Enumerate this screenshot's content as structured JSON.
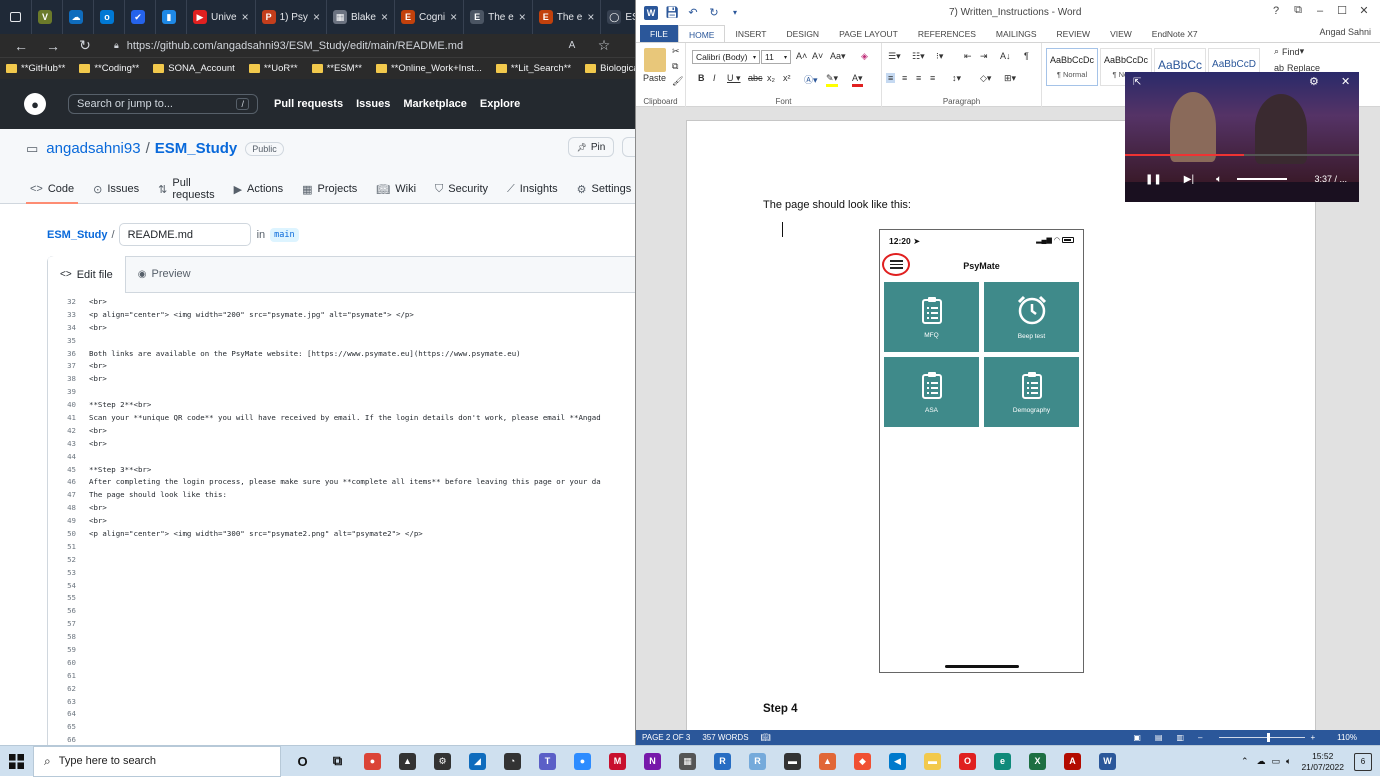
{
  "browser": {
    "tabs": [
      {
        "icon": "V",
        "color": "#6b7a2a",
        "label": ""
      },
      {
        "icon": "☁",
        "color": "#0f6cbd",
        "label": ""
      },
      {
        "icon": "o",
        "color": "#0078d4",
        "label": ""
      },
      {
        "icon": "✔",
        "color": "#2563eb",
        "label": ""
      },
      {
        "icon": "▮",
        "color": "#1e88e5",
        "label": ""
      },
      {
        "icon": "▶",
        "color": "#e02020",
        "label": "Unive"
      },
      {
        "icon": "P",
        "color": "#c43e1c",
        "label": "1) Psy"
      },
      {
        "icon": "▦",
        "color": "#6b7280",
        "label": "Blake"
      },
      {
        "icon": "E",
        "color": "#c2410c",
        "label": "Cogni"
      },
      {
        "icon": "E",
        "color": "#4b5563",
        "label": "The e"
      },
      {
        "icon": "E",
        "color": "#c2410c",
        "label": "The e"
      },
      {
        "icon": "◯",
        "color": "#374151",
        "label": "ESM"
      }
    ],
    "address": "https://github.com/angadsahni93/ESM_Study/edit/main/README.md",
    "bookmarks": [
      {
        "label": "**GitHub**"
      },
      {
        "label": "**Coding**"
      },
      {
        "label": "SONA_Account"
      },
      {
        "label": "**UoR**"
      },
      {
        "label": "**ESM**"
      },
      {
        "label": "**Online_Work+Inst..."
      },
      {
        "label": "**Lit_Search**"
      },
      {
        "label": "Biological Psychia"
      }
    ]
  },
  "github": {
    "search_placeholder": "Search or jump to...",
    "search_key": "/",
    "nav": [
      "Pull requests",
      "Issues",
      "Marketplace",
      "Explore"
    ],
    "owner": "angadsahni93",
    "repo": "ESM_Study",
    "visibility": "Public",
    "pin": "Pin",
    "tabs": [
      "Code",
      "Issues",
      "Pull requests",
      "Actions",
      "Projects",
      "Wiki",
      "Security",
      "Insights",
      "Settings"
    ],
    "breadcrumb_repo": "ESM_Study",
    "filename": "README.md",
    "in_label": "in",
    "branch": "main",
    "edit_tab": "Edit file",
    "preview_tab": "Preview",
    "code_lines": [
      {
        "n": "32",
        "t": "<br>"
      },
      {
        "n": "33",
        "t": "<p align=\"center\"> <img width=\"200\" src=\"psymate.jpg\" alt=\"psymate\"> </p>"
      },
      {
        "n": "34",
        "t": "<br>"
      },
      {
        "n": "35",
        "t": ""
      },
      {
        "n": "36",
        "t": "Both links are available on the PsyMate website: [https://www.psymate.eu](https://www.psymate.eu)"
      },
      {
        "n": "37",
        "t": "<br>"
      },
      {
        "n": "38",
        "t": "<br>"
      },
      {
        "n": "39",
        "t": ""
      },
      {
        "n": "40",
        "t": "**Step 2**<br>"
      },
      {
        "n": "41",
        "t": "Scan your **unique QR code** you will have received by email. If the login details don't work, please email **Angad"
      },
      {
        "n": "42",
        "t": "<br>"
      },
      {
        "n": "43",
        "t": "<br>"
      },
      {
        "n": "44",
        "t": ""
      },
      {
        "n": "45",
        "t": "**Step 3**<br>"
      },
      {
        "n": "46",
        "t": "After completing the login process, please make sure you **complete all items** before leaving this page or your da"
      },
      {
        "n": "47",
        "t": "The page should look like this:"
      },
      {
        "n": "48",
        "t": "<br>"
      },
      {
        "n": "49",
        "t": "<br>"
      },
      {
        "n": "50",
        "t": "<p align=\"center\"> <img width=\"300\" src=\"psymate2.png\" alt=\"psymate2\"> </p>"
      },
      {
        "n": "51",
        "t": ""
      },
      {
        "n": "52",
        "t": ""
      },
      {
        "n": "53",
        "t": ""
      },
      {
        "n": "54",
        "t": ""
      },
      {
        "n": "55",
        "t": ""
      },
      {
        "n": "56",
        "t": ""
      },
      {
        "n": "57",
        "t": ""
      },
      {
        "n": "58",
        "t": ""
      },
      {
        "n": "59",
        "t": ""
      },
      {
        "n": "60",
        "t": ""
      },
      {
        "n": "61",
        "t": ""
      },
      {
        "n": "62",
        "t": ""
      },
      {
        "n": "63",
        "t": ""
      },
      {
        "n": "64",
        "t": ""
      },
      {
        "n": "65",
        "t": ""
      },
      {
        "n": "66",
        "t": ""
      }
    ]
  },
  "word": {
    "doc_title": "7) Written_Instructions - Word",
    "ribbon_tabs": [
      "FILE",
      "HOME",
      "INSERT",
      "DESIGN",
      "PAGE LAYOUT",
      "REFERENCES",
      "MAILINGS",
      "REVIEW",
      "VIEW",
      "EndNote X7"
    ],
    "user": "Angad Sahni",
    "font_name": "Calibri (Body)",
    "font_size": "11",
    "group_labels": {
      "clipboard": "Clipboard",
      "font": "Font",
      "paragraph": "Paragraph"
    },
    "paste": "Paste",
    "styles": [
      {
        "sample": "AaBbCcDc",
        "name": "¶ Normal"
      },
      {
        "sample": "AaBbCcDc",
        "name": "¶ No Sp"
      },
      {
        "sample": "AaBbCc",
        "name": ""
      },
      {
        "sample": "AaBbCcD",
        "name": ""
      }
    ],
    "find": "Find",
    "replace": "Replace",
    "body_text": "The page should look like this:",
    "step_heading": "Step 4",
    "status": {
      "page": "PAGE 2 OF 3",
      "words": "357 WORDS",
      "zoom": "110%"
    }
  },
  "phone": {
    "time": "12:20",
    "title": "PsyMate",
    "tiles": [
      {
        "label": "MFQ",
        "icon": "clipboard-icon"
      },
      {
        "label": "Beep test",
        "icon": "alarm-clock-icon"
      },
      {
        "label": "ASA",
        "icon": "clipboard-icon"
      },
      {
        "label": "Demography",
        "icon": "clipboard-icon"
      }
    ],
    "tile_color": "#3f8a8a"
  },
  "video": {
    "time": "3:37 / ...",
    "progress_fraction": 0.51
  },
  "taskbar": {
    "search_placeholder": "Type here to search",
    "apps": [
      {
        "name": "cortana-icon",
        "glyph": "O",
        "color": "#111"
      },
      {
        "name": "task-view-icon",
        "glyph": "⧉",
        "color": "#111"
      },
      {
        "name": "chrome-icon",
        "glyph": "●",
        "color": "#db4437"
      },
      {
        "name": "inkscape-icon",
        "glyph": "▲",
        "color": "#333"
      },
      {
        "name": "settings-icon",
        "glyph": "⚙",
        "color": "#333"
      },
      {
        "name": "app-icon",
        "glyph": "◢",
        "color": "#0f6cbd"
      },
      {
        "name": "clock-app-icon",
        "glyph": "◔",
        "color": "#333"
      },
      {
        "name": "teams-icon",
        "glyph": "T",
        "color": "#5b5fc7"
      },
      {
        "name": "zoom-icon",
        "glyph": "●",
        "color": "#2d8cff"
      },
      {
        "name": "mendeley-icon",
        "glyph": "M",
        "color": "#c8102e"
      },
      {
        "name": "onenote-icon",
        "glyph": "N",
        "color": "#7719aa"
      },
      {
        "name": "calculator-icon",
        "glyph": "▦",
        "color": "#555"
      },
      {
        "name": "r-icon",
        "glyph": "R",
        "color": "#276dc3"
      },
      {
        "name": "rstudio-icon",
        "glyph": "R",
        "color": "#75aadb"
      },
      {
        "name": "terminal-icon",
        "glyph": "▬",
        "color": "#333"
      },
      {
        "name": "matlab-icon",
        "glyph": "▲",
        "color": "#e16737"
      },
      {
        "name": "git-icon",
        "glyph": "◆",
        "color": "#f05033"
      },
      {
        "name": "vscode-icon",
        "glyph": "◀",
        "color": "#007acc"
      },
      {
        "name": "explorer-icon",
        "glyph": "▬",
        "color": "#f2c94c"
      },
      {
        "name": "opera-icon",
        "glyph": "O",
        "color": "#e02020"
      },
      {
        "name": "edge-icon",
        "glyph": "e",
        "color": "#0f8a7a"
      },
      {
        "name": "excel-icon",
        "glyph": "X",
        "color": "#1d6f42"
      },
      {
        "name": "acrobat-icon",
        "glyph": "A",
        "color": "#b30b00"
      },
      {
        "name": "word-icon",
        "glyph": "W",
        "color": "#2b579a"
      }
    ],
    "time": "15:52",
    "date": "21/07/2022",
    "notifications": "6"
  }
}
